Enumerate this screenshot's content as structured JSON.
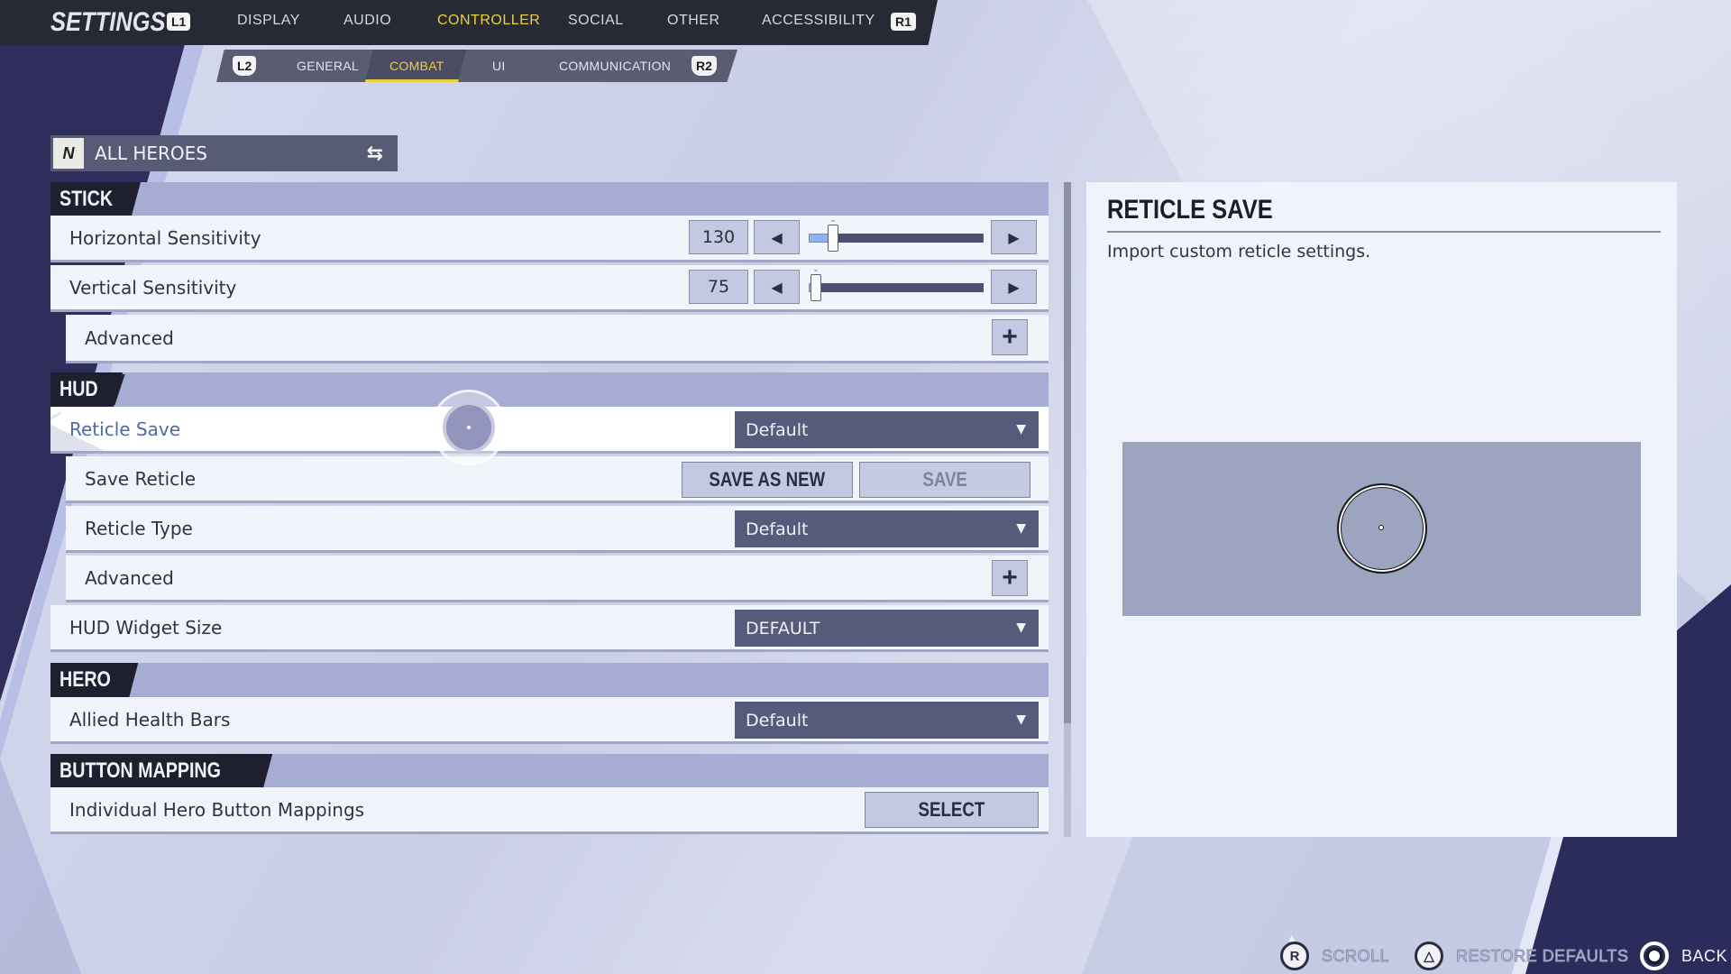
{
  "header": {
    "title": "SETTINGS",
    "left_bumper": "L1",
    "right_bumper": "R1",
    "tabs": [
      {
        "label": "DISPLAY",
        "active": false
      },
      {
        "label": "AUDIO",
        "active": false
      },
      {
        "label": "CONTROLLER",
        "active": true
      },
      {
        "label": "SOCIAL",
        "active": false
      },
      {
        "label": "OTHER",
        "active": false
      },
      {
        "label": "ACCESSIBILITY",
        "active": false
      }
    ],
    "active_color": "#e8d23a"
  },
  "subnav": {
    "left_trigger": "L2",
    "right_trigger": "R2",
    "tabs": [
      {
        "label": "GENERAL",
        "active": false
      },
      {
        "label": "COMBAT",
        "active": true
      },
      {
        "label": "UI",
        "active": false
      },
      {
        "label": "COMMUNICATION",
        "active": false
      }
    ]
  },
  "hero_selector": {
    "logo_icon": "game-logo-icon",
    "label": "ALL HEROES",
    "swap_icon": "swap-arrows-icon"
  },
  "sections": {
    "stick": {
      "title": "STICK",
      "horizontal_sensitivity": {
        "label": "Horizontal Sensitivity",
        "value": "130",
        "slider_fraction": 0.14
      },
      "vertical_sensitivity": {
        "label": "Vertical Sensitivity",
        "value": "75",
        "slider_fraction": 0.04
      },
      "advanced": {
        "label": "Advanced",
        "expand_icon": "plus-icon"
      }
    },
    "hud": {
      "title": "HUD",
      "reticle_save": {
        "label": "Reticle Save",
        "value": "Default",
        "selected": true
      },
      "save_reticle": {
        "label": "Save Reticle",
        "save_as_new": "SAVE AS NEW",
        "save": "SAVE"
      },
      "reticle_type": {
        "label": "Reticle Type",
        "value": "Default"
      },
      "advanced": {
        "label": "Advanced",
        "expand_icon": "plus-icon"
      },
      "hud_widget_size": {
        "label": "HUD Widget Size",
        "value": "DEFAULT"
      }
    },
    "hero": {
      "title": "HERO",
      "allied_health_bars": {
        "label": "Allied Health Bars",
        "value": "Default"
      }
    },
    "button_mapping": {
      "title": "BUTTON MAPPING",
      "individual_hero": {
        "label": "Individual Hero Button Mappings",
        "button": "SELECT"
      }
    }
  },
  "glyphs": {
    "left_arrow": "◀",
    "right_arrow": "▶",
    "dropdown": "▼",
    "plus": "+",
    "swap": "⇆",
    "caret": "⌄",
    "logo": "N"
  },
  "info_panel": {
    "title": "RETICLE SAVE",
    "description": "Import custom reticle settings."
  },
  "footer": {
    "scroll": {
      "button": "R",
      "label": "SCROLL"
    },
    "restore": {
      "button": "△",
      "label": "RESTORE DEFAULTS"
    },
    "back": {
      "label": "BACK"
    }
  }
}
